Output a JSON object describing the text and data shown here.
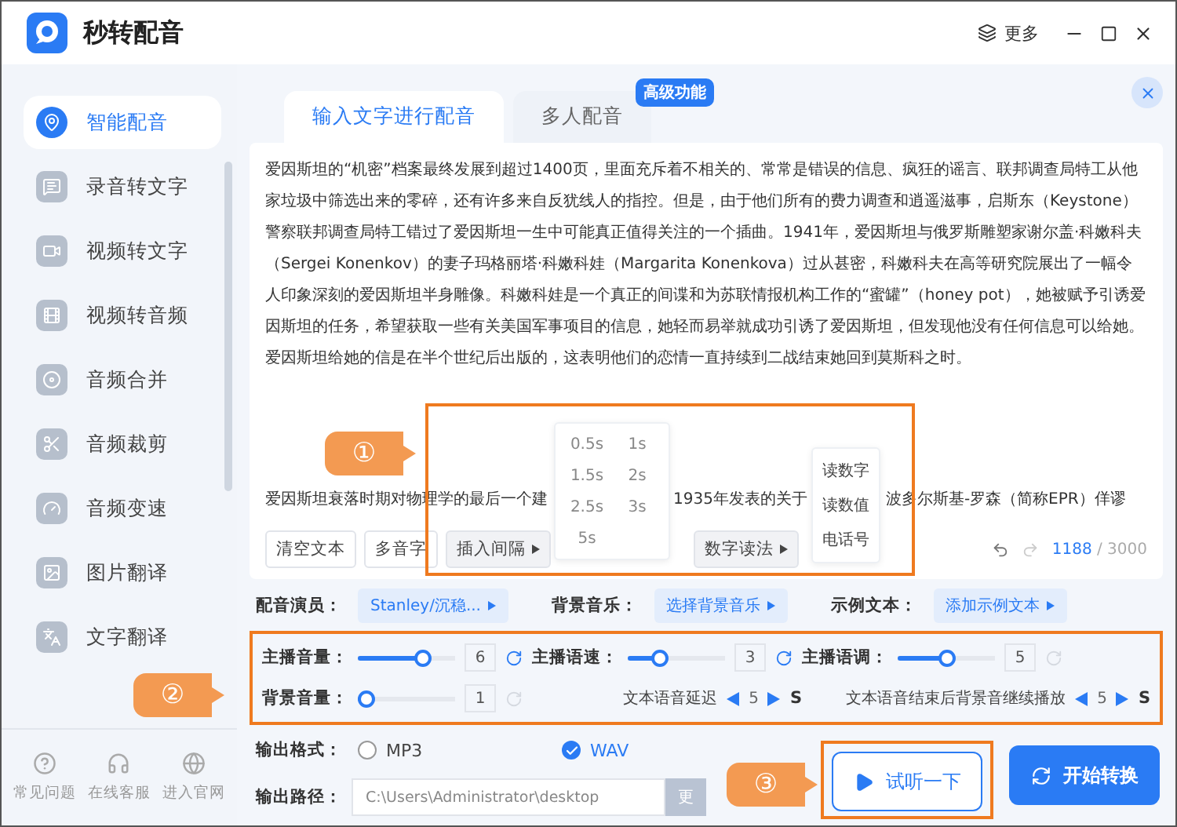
{
  "app": {
    "title": "秒转配音",
    "more": "更多"
  },
  "sidebar": {
    "items": [
      {
        "label": "智能配音",
        "selected": true
      },
      {
        "label": "录音转文字",
        "selected": false
      },
      {
        "label": "视频转文字",
        "selected": false
      },
      {
        "label": "视频转音频",
        "selected": false
      },
      {
        "label": "音频合并",
        "selected": false
      },
      {
        "label": "音频裁剪",
        "selected": false
      },
      {
        "label": "音频变速",
        "selected": false
      },
      {
        "label": "图片翻译",
        "selected": false
      },
      {
        "label": "文字翻译",
        "selected": false
      }
    ],
    "footer": [
      "常见问题",
      "在线客服",
      "进入官网"
    ]
  },
  "tabs": [
    {
      "label": "输入文字进行配音",
      "selected": true
    },
    {
      "label": "多人配音",
      "selected": false
    }
  ],
  "badge": "高级功能",
  "editor": {
    "paragraph": "爱因斯坦的“机密”档案最终发展到超过1400页，里面充斥着不相关的、常常是错误的信息、疯狂的谣言、联邦调查局特工从他家垃圾中筛选出来的零碎，还有许多来自反犹线人的指控。但是，由于他们所有的费力调查和逍遥滋事，启斯东（Keystone）警察联邦调查局特工错过了爱因斯坦一生中可能真正值得关注的一个插曲。1941年，爱因斯坦与俄罗斯雕塑家谢尔盖·科嫩科夫（Sergei Konenkov）的妻子玛格丽塔·科嫩科娃（Margarita Konenkova）过从甚密，科嫩科夫在高等研究院展出了一幅令人印象深刻的爱因斯坦半身雕像。科嫩科娃是一个真正的间谍和为苏联情报机构工作的“蜜罐”（honey pot），她被赋予引诱爱因斯坦的任务，希望获取一些有关美国军事项目的信息，她轻而易举就成功引诱了爱因斯坦，但发现他没有任何信息可以给她。爱因斯坦给她的信是在半个世纪后出版的，这表明他们的恋情一直持续到二战结束她回到莫斯科之时。",
    "fragments": [
      "爱因斯坦衰落时期对物理学的最后一个建",
      "1935年发表的关于",
      "波多尔斯基-罗森（简称EPR）佯谬"
    ],
    "buttons": [
      {
        "label": "清空文本",
        "kind": "plain"
      },
      {
        "label": "多音字",
        "kind": "plain"
      },
      {
        "label": "插入间隔",
        "kind": "menu"
      },
      {
        "label": "数字读法",
        "kind": "menu"
      }
    ],
    "interval_menu": [
      "0.5s",
      "1s",
      "1.5s",
      "2s",
      "2.5s",
      "3s",
      "5s"
    ],
    "number_menu": [
      "读数字",
      "读数值",
      "电话号"
    ],
    "count": "1188",
    "limit": "/ 3000"
  },
  "selectors": [
    {
      "label": "配音演员：",
      "value": "Stanley/沉稳..."
    },
    {
      "label": "背景音乐：",
      "value": "选择背景音乐"
    },
    {
      "label": "示例文本：",
      "value": "添加示例文本"
    }
  ],
  "sliders": [
    {
      "label": "主播音量：",
      "level": 0.7,
      "value": "6",
      "reset_enabled": true
    },
    {
      "label": "主播语速：",
      "level": 0.3,
      "value": "3",
      "reset_enabled": true
    },
    {
      "label": "主播语调：",
      "level": 0.5,
      "value": "5",
      "reset_enabled": false
    },
    {
      "label": "背景音量：",
      "level": 0,
      "value": "1",
      "reset_enabled": false
    }
  ],
  "delays": [
    {
      "label": "文本语音延迟",
      "value": "5",
      "unit": "S"
    },
    {
      "label": "文本语音结束后背景音继续播放",
      "value": "5",
      "unit": "S"
    }
  ],
  "output": {
    "format_label": "输出格式：",
    "formats": [
      {
        "label": "MP3",
        "selected": false
      },
      {
        "label": "WAV",
        "selected": true
      }
    ],
    "path_label": "输出路径：",
    "path": "C:\\Users\\Administrator\\desktop",
    "change": "更"
  },
  "actions": [
    {
      "label": "试听一下",
      "kind": "preview"
    },
    {
      "label": "开始转换",
      "kind": "convert"
    }
  ],
  "callouts": [
    "①",
    "②",
    "③"
  ]
}
